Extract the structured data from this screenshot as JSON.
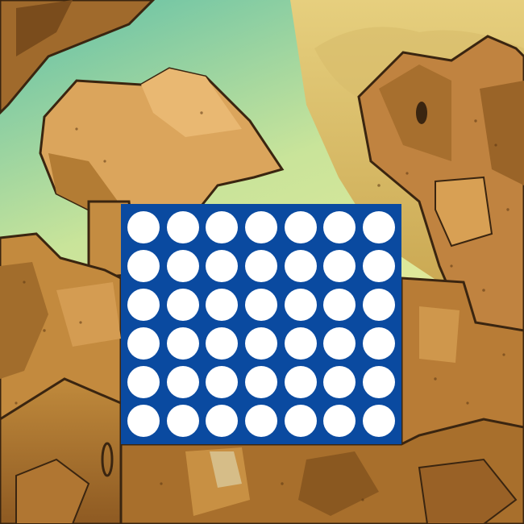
{
  "colors": {
    "sky_top": "#5fbfa8",
    "sky_mid": "#c9e49a",
    "sky_low": "#f3ec9a",
    "haze": "#d9bf6a",
    "rock_light": "#d9a55b",
    "rock_mid": "#b98237",
    "rock_dark": "#8a5a22",
    "rock_shadow": "#6b4218",
    "outline": "#3a2510",
    "board_blue": "#0a4aa0",
    "hole_empty": "#ffffff"
  },
  "board": {
    "rows": 6,
    "columns": 7,
    "cells": [
      [
        "empty",
        "empty",
        "empty",
        "empty",
        "empty",
        "empty",
        "empty"
      ],
      [
        "empty",
        "empty",
        "empty",
        "empty",
        "empty",
        "empty",
        "empty"
      ],
      [
        "empty",
        "empty",
        "empty",
        "empty",
        "empty",
        "empty",
        "empty"
      ],
      [
        "empty",
        "empty",
        "empty",
        "empty",
        "empty",
        "empty",
        "empty"
      ],
      [
        "empty",
        "empty",
        "empty",
        "empty",
        "empty",
        "empty",
        "empty"
      ],
      [
        "empty",
        "empty",
        "empty",
        "empty",
        "empty",
        "empty",
        "empty"
      ]
    ]
  }
}
